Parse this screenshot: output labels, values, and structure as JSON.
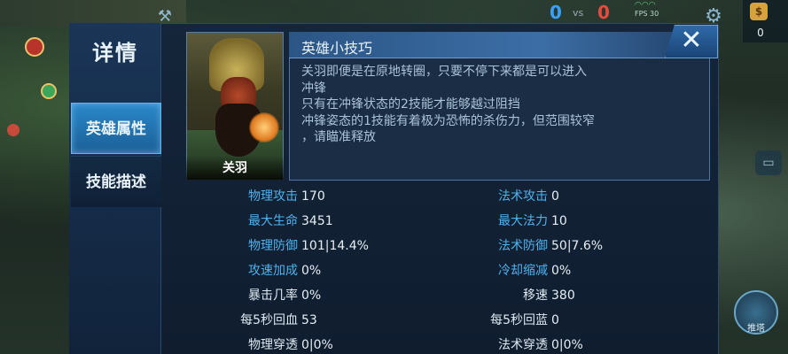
{
  "hud": {
    "score_blue": "0",
    "score_vs": "vs",
    "score_red": "0",
    "fps": "FPS 30",
    "coins": "0",
    "push_label": "推塔"
  },
  "sidebar": {
    "title": "详情",
    "tabs": [
      {
        "label": "英雄属性",
        "active": true
      },
      {
        "label": "技能描述",
        "active": false
      }
    ]
  },
  "hero": {
    "name": "关羽"
  },
  "tips": {
    "title": "英雄小技巧",
    "lines": [
      "关羽即便是在原地转圈，只要不停下来都是可以进入",
      "冲锋",
      "只有在冲锋状态的2技能才能够越过阻挡",
      "冲锋姿态的1技能有着极为恐怖的杀伤力，但范围较窄",
      "，请瞄准释放"
    ]
  },
  "stats": {
    "left": [
      {
        "label": "物理攻击",
        "value": "170",
        "highlight": true
      },
      {
        "label": "最大生命",
        "value": "3451",
        "highlight": true
      },
      {
        "label": "物理防御",
        "value": "101|14.4%",
        "highlight": true
      },
      {
        "label": "攻速加成",
        "value": "0%",
        "highlight": true
      },
      {
        "label": "暴击几率",
        "value": "0%",
        "highlight": false
      },
      {
        "label": "每5秒回血",
        "value": "53",
        "highlight": false
      },
      {
        "label": "物理穿透",
        "value": "0|0%",
        "highlight": false
      }
    ],
    "right": [
      {
        "label": "法术攻击",
        "value": "0",
        "highlight": true
      },
      {
        "label": "最大法力",
        "value": "10",
        "highlight": true
      },
      {
        "label": "法术防御",
        "value": "50|7.6%",
        "highlight": true
      },
      {
        "label": "冷却缩减",
        "value": "0%",
        "highlight": true
      },
      {
        "label": "移速",
        "value": "380",
        "highlight": false
      },
      {
        "label": "每5秒回蓝",
        "value": "0",
        "highlight": false
      },
      {
        "label": "法术穿透",
        "value": "0|0%",
        "highlight": false
      }
    ]
  },
  "colors": {
    "highlight_label": "#4eb2ee",
    "normal_label": "#dde8f1",
    "active_tab": "#2a88c9"
  }
}
